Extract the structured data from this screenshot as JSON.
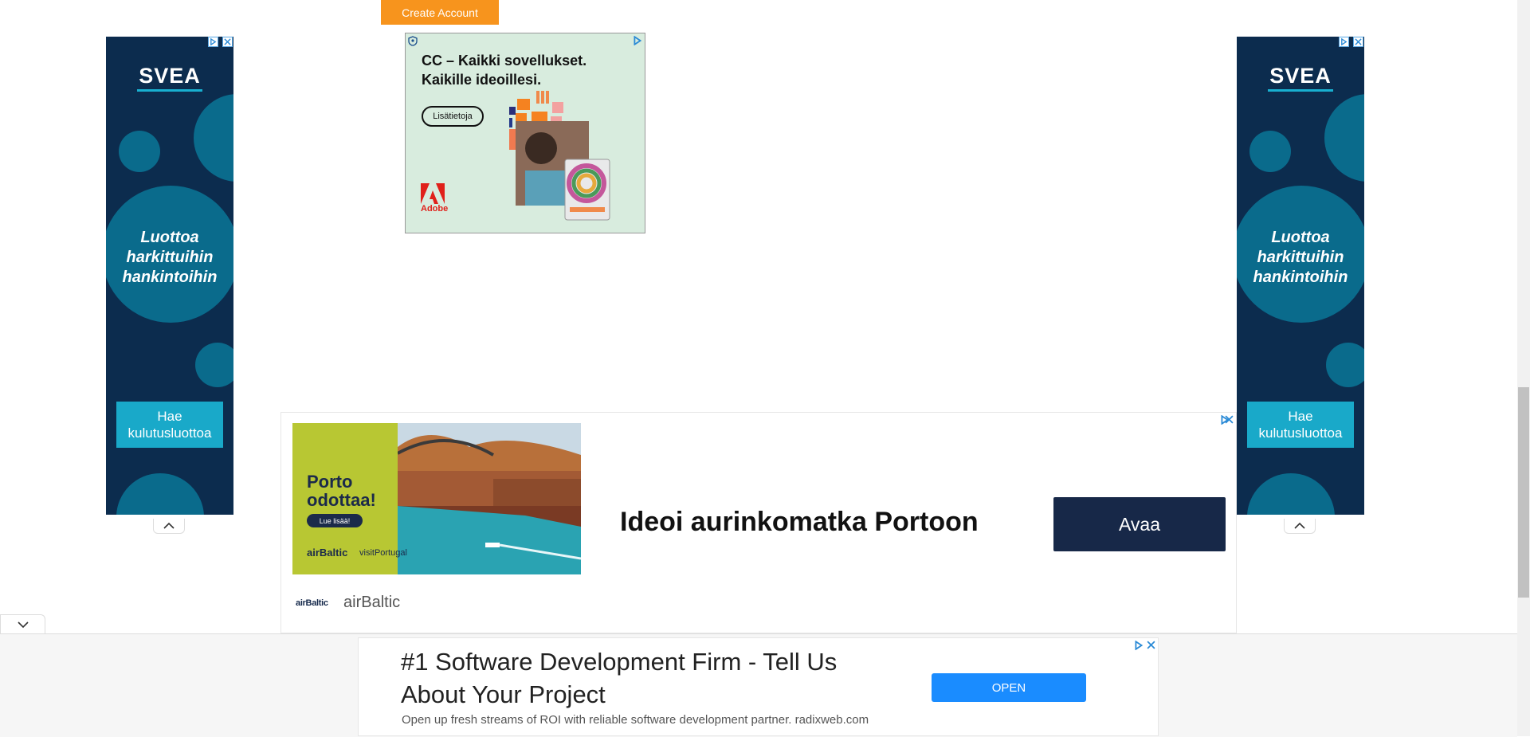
{
  "page": {
    "create_account_label": "Create Account"
  },
  "svea_ads": {
    "brand": "SVEA",
    "tagline_lines": [
      "Luottoa",
      "harkittuihin",
      "hankintoihin"
    ],
    "cta_lines": [
      "Hae",
      "kulutusluottoa"
    ],
    "colors": {
      "background": "#0c2c4e",
      "circles": "#0a6b8c",
      "button": "#19a9c9"
    }
  },
  "adobe_ad": {
    "headline_lines": [
      "CC – Kaikki sovellukset.",
      "Kaikille ideoillesi."
    ],
    "cta_label": "Lisätietoja",
    "brand": "Adobe"
  },
  "airbaltic_ad": {
    "image_headline_lines": [
      "Porto",
      "odottaa!"
    ],
    "image_cta": "Lue lisää!",
    "image_logos": [
      "airBaltic",
      "visitPortugal"
    ],
    "headline": "Ideoi aurinkomatka Portoon",
    "cta_label": "Avaa",
    "advertiser_logo": "airBaltic",
    "advertiser_name": "airBaltic",
    "colors": {
      "cta": "#172848"
    }
  },
  "bottom_ad": {
    "title": "#1 Software Development Firm - Tell Us About Your Project",
    "description": "Open up fresh streams of ROI with reliable software development partner. radixweb.com",
    "cta_label": "OPEN",
    "colors": {
      "cta": "#1a8cff"
    }
  },
  "icons": {
    "ad_choices": "adchoices-icon",
    "close": "close-icon",
    "collapse": "chevron-up-icon",
    "expand": "chevron-down-icon"
  }
}
